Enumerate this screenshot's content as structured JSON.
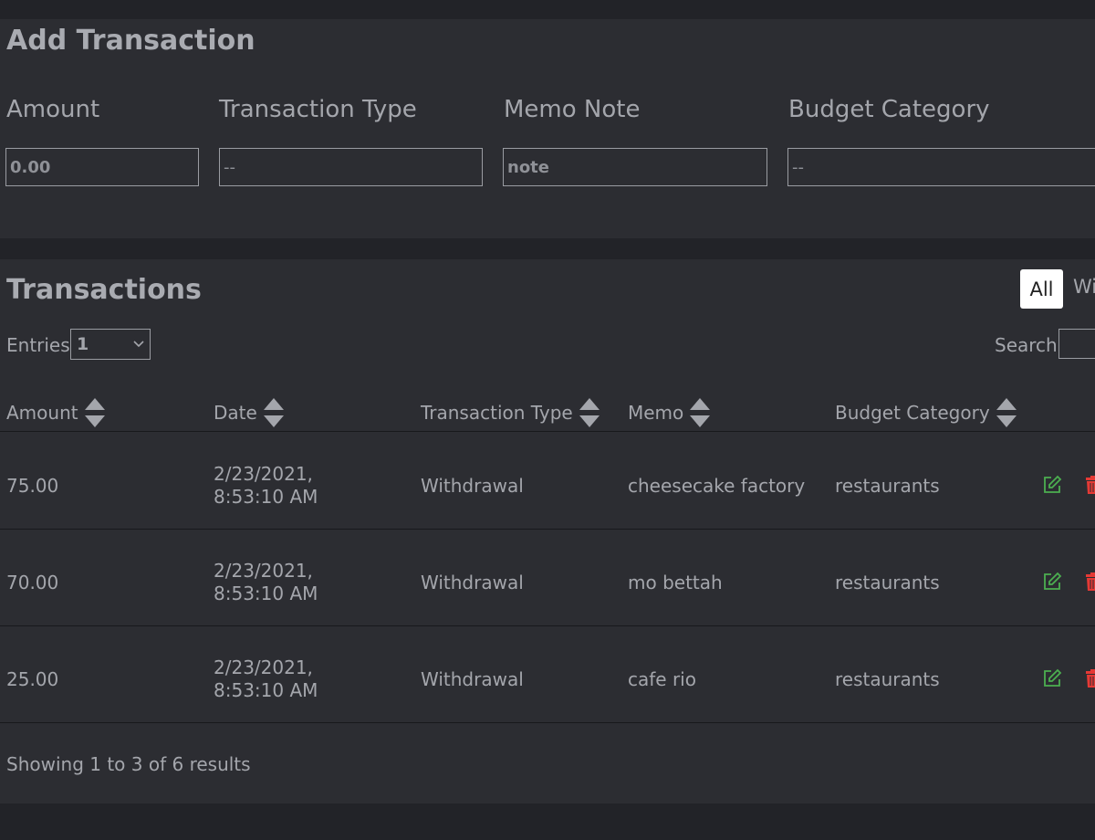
{
  "add_transaction": {
    "title": "Add Transaction",
    "fields": [
      {
        "label": "Amount",
        "value": "0.00"
      },
      {
        "label": "Transaction Type",
        "value": "--"
      },
      {
        "label": "Memo Note",
        "value": "note"
      },
      {
        "label": "Budget Category",
        "value": "--"
      }
    ]
  },
  "transactions": {
    "title": "Transactions",
    "filters": [
      "All",
      "Wi"
    ],
    "entries_label": "Entries",
    "entries_value": "1",
    "search_label": "Search",
    "columns": [
      "Amount",
      "Date",
      "Transaction Type",
      "Memo",
      "Budget Category"
    ],
    "rows": [
      {
        "amount": "75.00",
        "date": "2/23/2021, 8:53:10 AM",
        "type": "Withdrawal",
        "memo": "cheesecake factory",
        "category": "restaurants"
      },
      {
        "amount": "70.00",
        "date": "2/23/2021, 8:53:10 AM",
        "type": "Withdrawal",
        "memo": "mo bettah",
        "category": "restaurants"
      },
      {
        "amount": "25.00",
        "date": "2/23/2021, 8:53:10 AM",
        "type": "Withdrawal",
        "memo": "cafe rio",
        "category": "restaurants"
      }
    ],
    "footer": "Showing 1 to 3 of 6 results"
  },
  "colors": {
    "edit": "#4caf50",
    "delete": "#e53935"
  },
  "icons": {
    "sort": "sort-icon",
    "edit": "edit-icon",
    "delete": "trash-icon",
    "dropdown": "chevron-down-icon"
  }
}
